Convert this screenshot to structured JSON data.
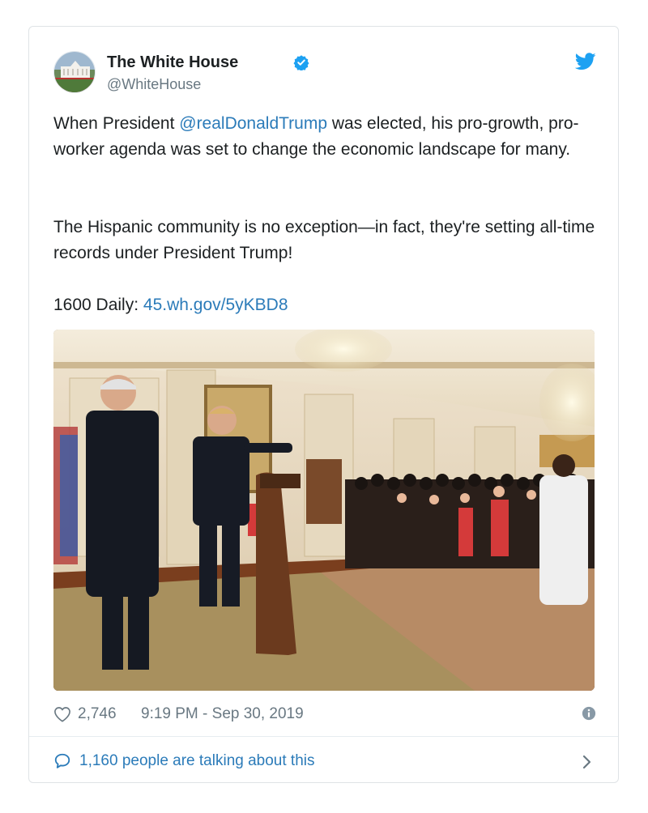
{
  "tweet": {
    "author": {
      "name": "The White House",
      "handle": "@WhiteHouse"
    },
    "text": {
      "p1_before": "When President ",
      "p1_mention": "@realDonaldTrump",
      "p1_after": " was elected, his pro-growth, pro-worker agenda was set to change the economic landscape for many.",
      "p2": "The Hispanic community is no exception—in fact, they're setting all-time records under President Trump!",
      "p3_label": "1600 Daily: ",
      "p3_link": "45.wh.gov/5yKBD8"
    },
    "likes": "2,746",
    "timestamp": "9:19 PM - Sep 30, 2019",
    "conversation": "1,160 people are talking about this"
  },
  "colors": {
    "link": "#2b7bb9",
    "muted": "#697882",
    "verified": "#1da1f2",
    "twitter_blue": "#1da1f2"
  },
  "icons": {
    "verified": "verified-badge-icon",
    "twitter": "twitter-bird-icon",
    "like": "heart-icon",
    "info": "info-icon",
    "reply": "speech-bubble-icon",
    "more": "chevron-right-icon"
  }
}
